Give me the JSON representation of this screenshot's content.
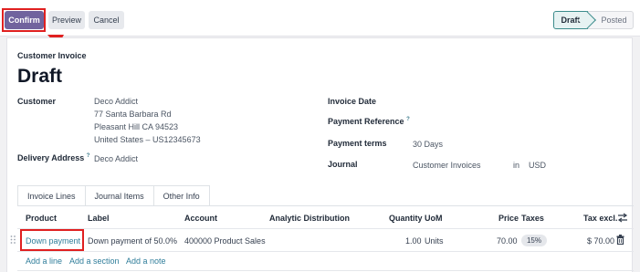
{
  "toolbar": {
    "confirm_label": "Confirm",
    "preview_label": "Preview",
    "cancel_label": "Cancel"
  },
  "statusbar": {
    "stages": [
      "Draft",
      "Posted"
    ],
    "active": "Draft"
  },
  "form": {
    "doc_type": "Customer Invoice",
    "title": "Draft",
    "customer": {
      "label": "Customer",
      "name": "Deco Addict",
      "address": [
        "77 Santa Barbara Rd",
        "Pleasant Hill CA 94523",
        "United States – US12345673"
      ]
    },
    "delivery_address": {
      "label": "Delivery Address",
      "help": "?",
      "value": "Deco Addict"
    },
    "invoice_date": {
      "label": "Invoice Date",
      "value": ""
    },
    "payment_reference": {
      "label": "Payment Reference",
      "help": "?",
      "value": ""
    },
    "payment_terms": {
      "label": "Payment terms",
      "value": "30 Days"
    },
    "journal": {
      "label": "Journal",
      "value": "Customer Invoices",
      "in_label": "in",
      "currency": "USD"
    }
  },
  "tabs": [
    "Invoice Lines",
    "Journal Items",
    "Other Info"
  ],
  "lines_table": {
    "columns": [
      "Product",
      "Label",
      "Account",
      "Analytic Distribution",
      "Quantity",
      "UoM",
      "Price",
      "Taxes",
      "Tax excl."
    ],
    "rows": [
      {
        "product": "Down payment",
        "label": "Down payment of 50.0%",
        "account": "400000 Product Sales",
        "analytic": "",
        "quantity": "1.00",
        "uom": "Units",
        "price": "70.00",
        "taxes": "15%",
        "tax_excl": "$ 70.00"
      }
    ],
    "actions": [
      "Add a line",
      "Add a section",
      "Add a note"
    ]
  },
  "icons": {
    "drag_handle": "drag-handle-icon",
    "delete": "trash-icon",
    "column_settings": "column-toggle-icon"
  },
  "colors": {
    "primary": "#71639e",
    "highlight": "#e02020",
    "link": "#2f7d9a",
    "active_stage": "#3b8b8b"
  }
}
